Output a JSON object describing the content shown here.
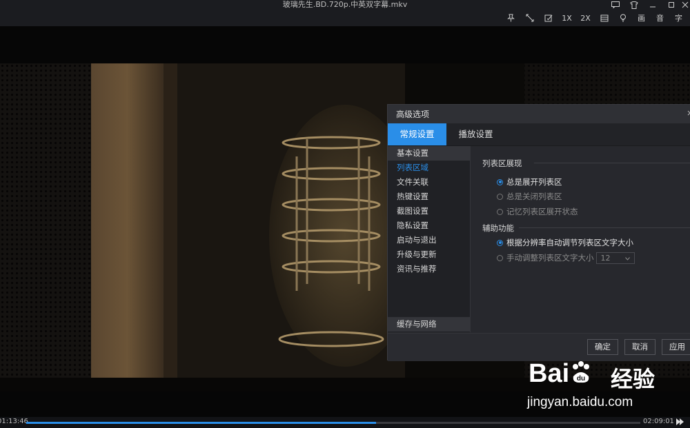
{
  "window": {
    "title": "玻璃先生.BD.720p.中英双字幕.mkv"
  },
  "toolbar": {
    "items": [
      {
        "icon": "pin-icon"
      },
      {
        "icon": "fullscreen-icon"
      },
      {
        "icon": "edit-icon"
      },
      {
        "label": "1X"
      },
      {
        "label": "2X"
      },
      {
        "icon": "list-icon"
      },
      {
        "icon": "bulb-icon"
      },
      {
        "label": "画"
      },
      {
        "label": "音"
      },
      {
        "label": "字"
      }
    ]
  },
  "player": {
    "current_time": "01:13:46",
    "total_time": "02:09:01",
    "progress": 0.57
  },
  "dialog": {
    "title": "高级选项",
    "tabs": [
      {
        "label": "常规设置",
        "active": true
      },
      {
        "label": "播放设置",
        "active": false
      }
    ],
    "nav": [
      {
        "label": "基本设置",
        "selected": true
      },
      {
        "label": "列表区域",
        "active": true
      },
      {
        "label": "文件关联"
      },
      {
        "label": "热键设置"
      },
      {
        "label": "截图设置"
      },
      {
        "label": "隐私设置"
      },
      {
        "label": "启动与退出"
      },
      {
        "label": "升级与更新"
      },
      {
        "label": "资讯与推荐"
      }
    ],
    "nav_bottom": "缓存与网络",
    "sections": [
      {
        "title": "列表区展现",
        "options": [
          {
            "label": "总是展开列表区",
            "checked": true
          },
          {
            "label": "总是关闭列表区",
            "checked": false
          },
          {
            "label": "记忆列表区展开状态",
            "checked": false
          }
        ]
      },
      {
        "title": "辅助功能",
        "options": [
          {
            "label": "根据分辨率自动调节列表区文字大小",
            "checked": true
          },
          {
            "label": "手动调整列表区文字大小",
            "checked": false
          }
        ]
      }
    ],
    "font_size_select": "12",
    "buttons": {
      "ok": "确定",
      "cancel": "取消",
      "apply": "应用"
    }
  },
  "watermark": {
    "logo_text": "Bai",
    "logo_suffix": "经验",
    "url": "jingyan.baidu.com"
  }
}
